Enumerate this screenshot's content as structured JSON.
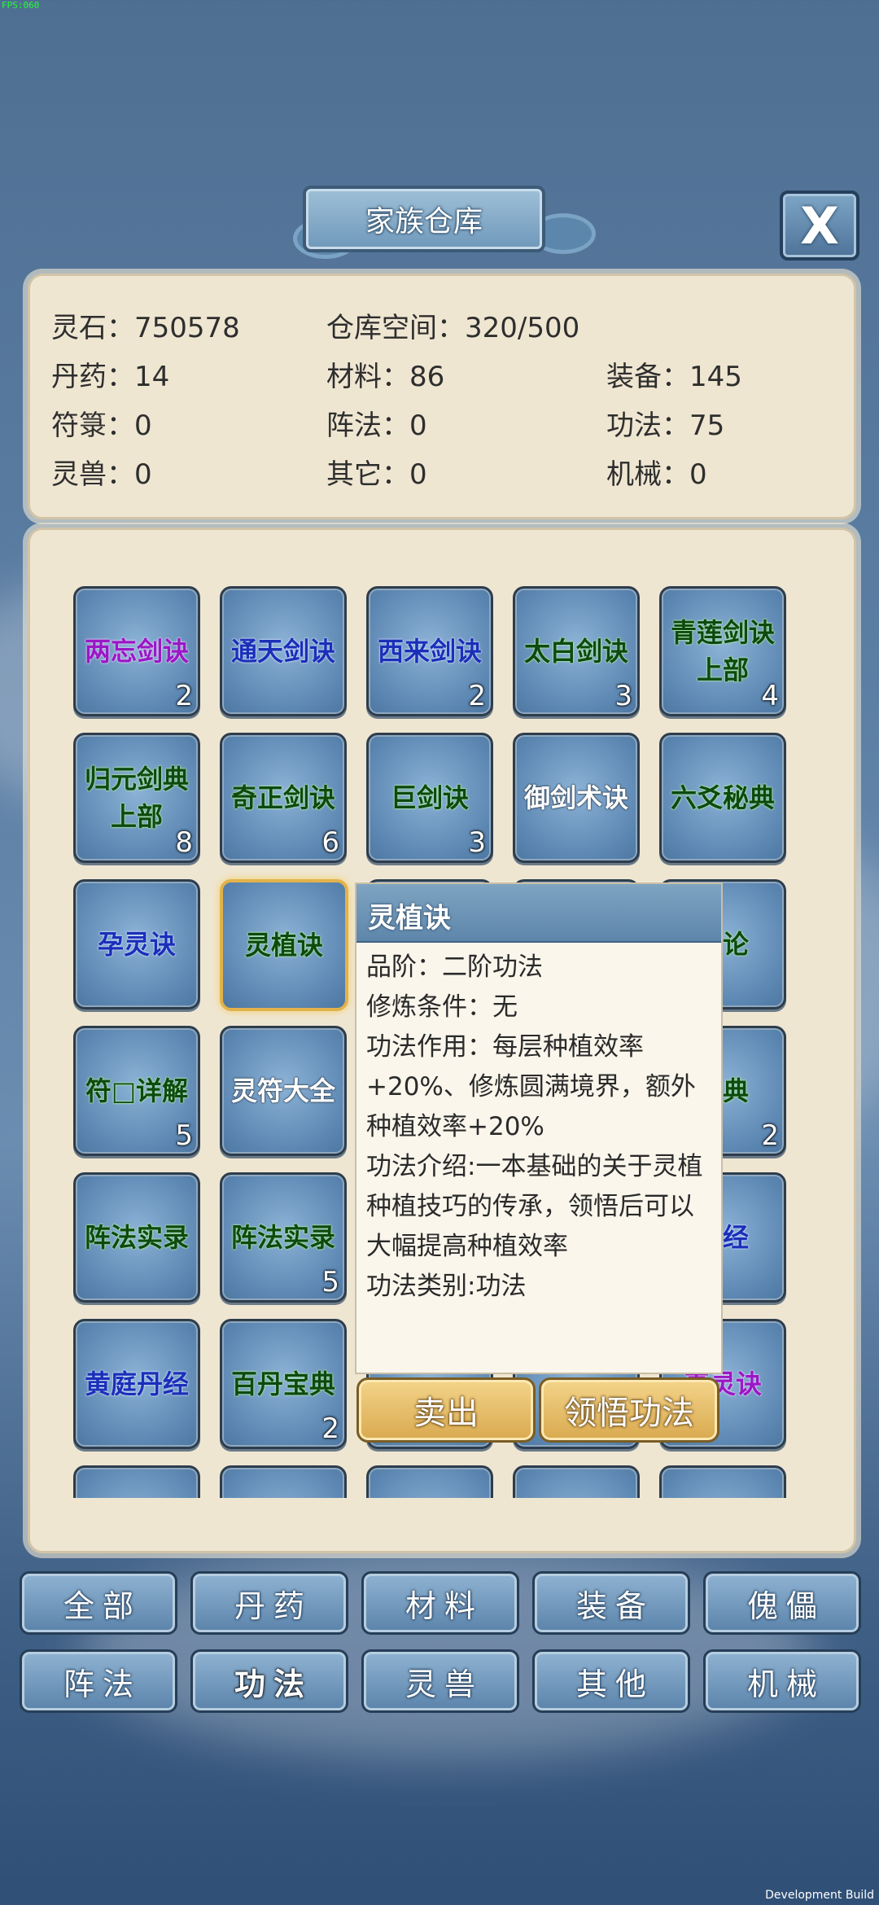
{
  "debug": {
    "fps": "FPS:060",
    "build": "Development Build"
  },
  "window": {
    "title": "家族仓库",
    "close_label": "X"
  },
  "stats": {
    "lingshi": "灵石：750578",
    "space": "仓库空间：320/500",
    "danyao": "丹药：14",
    "cailiao": "材料：86",
    "zhuangbei": "装备：145",
    "fulu": "符箓：0",
    "zhenfa": "阵法：0",
    "gongfa": "功法：75",
    "lingshou": "灵兽：0",
    "qita": "其它：0",
    "jixie": "机械：0"
  },
  "items": [
    {
      "name": "两忘剑诀",
      "count": "2",
      "quality": "purple"
    },
    {
      "name": "通天剑诀",
      "count": "",
      "quality": "blue"
    },
    {
      "name": "西来剑诀",
      "count": "2",
      "quality": "blue"
    },
    {
      "name": "太白剑诀",
      "count": "3",
      "quality": "green"
    },
    {
      "name": "青莲剑诀上部",
      "count": "4",
      "quality": "green"
    },
    {
      "name": "归元剑典上部",
      "count": "8",
      "quality": "green"
    },
    {
      "name": "奇正剑诀",
      "count": "6",
      "quality": "green"
    },
    {
      "name": "巨剑诀",
      "count": "3",
      "quality": "green"
    },
    {
      "name": "御剑术诀",
      "count": "",
      "quality": "white"
    },
    {
      "name": "六爻秘典",
      "count": "",
      "quality": "green"
    },
    {
      "name": "孕灵诀",
      "count": "",
      "quality": "blue"
    },
    {
      "name": "灵植诀",
      "count": "",
      "quality": "green"
    },
    {
      "name": "",
      "count": "",
      "quality": "blue"
    },
    {
      "name": "",
      "count": "",
      "quality": "blue"
    },
    {
      "name": "杂论",
      "count": "",
      "quality": "green"
    },
    {
      "name": "符□详解",
      "count": "5",
      "quality": "green"
    },
    {
      "name": "灵符大全",
      "count": "",
      "quality": "white"
    },
    {
      "name": "",
      "count": "",
      "quality": "blue"
    },
    {
      "name": "",
      "count": "",
      "quality": "blue"
    },
    {
      "name": "宝典",
      "count": "2",
      "quality": "green"
    },
    {
      "name": "阵法实录",
      "count": "",
      "quality": "green"
    },
    {
      "name": "阵法实录",
      "count": "5",
      "quality": "green"
    },
    {
      "name": "",
      "count": "",
      "quality": "blue"
    },
    {
      "name": "",
      "count": "",
      "quality": "blue"
    },
    {
      "name": "心经",
      "count": "",
      "quality": "blue"
    },
    {
      "name": "黄庭丹经",
      "count": "",
      "quality": "blue"
    },
    {
      "name": "百丹宝典",
      "count": "2",
      "quality": "green"
    },
    {
      "name": "",
      "count": "",
      "quality": "blue"
    },
    {
      "name": "",
      "count": "",
      "quality": "blue"
    },
    {
      "name": "真灵诀",
      "count": "",
      "quality": "purple"
    }
  ],
  "tooltip": {
    "title": "灵植诀",
    "lines": [
      "品阶：二阶功法",
      "修炼条件：无",
      "功法作用：每层种植效率+20%、修炼圆满境界，额外种植效率+20%",
      "功法介绍:一本基础的关于灵植种植技巧的传承，领悟后可以大幅提高种植效率",
      "功法类别:功法"
    ],
    "sell_label": "卖出",
    "learn_label": "领悟功法"
  },
  "tabs": [
    {
      "label": "全部",
      "active": false
    },
    {
      "label": "丹药",
      "active": false
    },
    {
      "label": "材料",
      "active": false
    },
    {
      "label": "装备",
      "active": false
    },
    {
      "label": "傀儡",
      "active": false
    },
    {
      "label": "阵法",
      "active": false
    },
    {
      "label": "功法",
      "active": true
    },
    {
      "label": "灵兽",
      "active": false
    },
    {
      "label": "其他",
      "active": false
    },
    {
      "label": "机械",
      "active": false
    }
  ],
  "colors": {
    "purple": "#9b17c6",
    "blue": "#1a2fb8",
    "green": "#0c4a10",
    "white": "#ffffff",
    "panel": "#efe6d2",
    "accent_gold": "#e2b24a"
  }
}
